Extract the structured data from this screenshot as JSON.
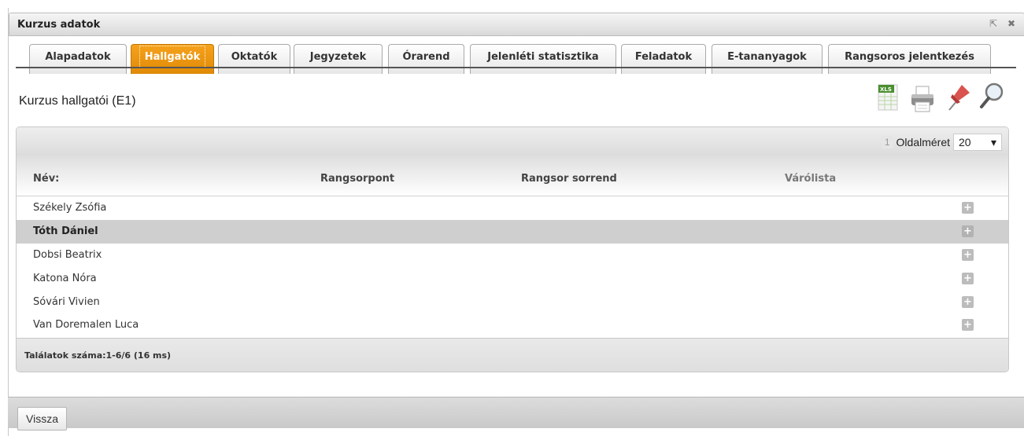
{
  "window": {
    "title": "Kurzus adatok",
    "popout_glyph": "⇱",
    "close_glyph": "✖"
  },
  "tabs": [
    {
      "label": "Alapadatok",
      "active": false
    },
    {
      "label": "Hallgatók",
      "active": true
    },
    {
      "label": "Oktatók",
      "active": false
    },
    {
      "label": "Jegyzetek",
      "active": false
    },
    {
      "label": "Órarend",
      "active": false
    },
    {
      "label": "Jelenléti statisztika",
      "active": false
    },
    {
      "label": "Feladatok",
      "active": false
    },
    {
      "label": "E-tananyagok",
      "active": false
    },
    {
      "label": "Rangsoros jelentkezés",
      "active": false
    }
  ],
  "section": {
    "title": "Kurzus hallgatói (E1)"
  },
  "toolbar": {
    "icons": [
      "xls-export-icon",
      "print-icon",
      "pin-icon",
      "search-icon"
    ],
    "xls_badge": "XLS"
  },
  "pager": {
    "current_page": "1",
    "page_size_label": "Oldalméret",
    "page_size_value": "20",
    "dropdown_glyph": "▾"
  },
  "table": {
    "columns": [
      "Név:",
      "Rangsorpont",
      "Rangsor sorrend",
      "Várólista"
    ],
    "rows": [
      {
        "name": "Székely Zsófia",
        "selected": false
      },
      {
        "name": "Tóth Dániel",
        "selected": true
      },
      {
        "name": "Dobsi Beatrix",
        "selected": false
      },
      {
        "name": "Katona Nóra",
        "selected": false
      },
      {
        "name": "Sóvári Vivien",
        "selected": false
      },
      {
        "name": "Van Doremalen Luca",
        "selected": false
      }
    ],
    "expand_glyph": "+"
  },
  "footer": {
    "results": "Találatok száma:1-6/6 (16 ms)"
  },
  "bottom": {
    "back_label": "Vissza"
  },
  "colors": {
    "active_tab": "#f39c12",
    "selected_row": "#cfcfcf",
    "accent_icon": "#d9534f"
  }
}
